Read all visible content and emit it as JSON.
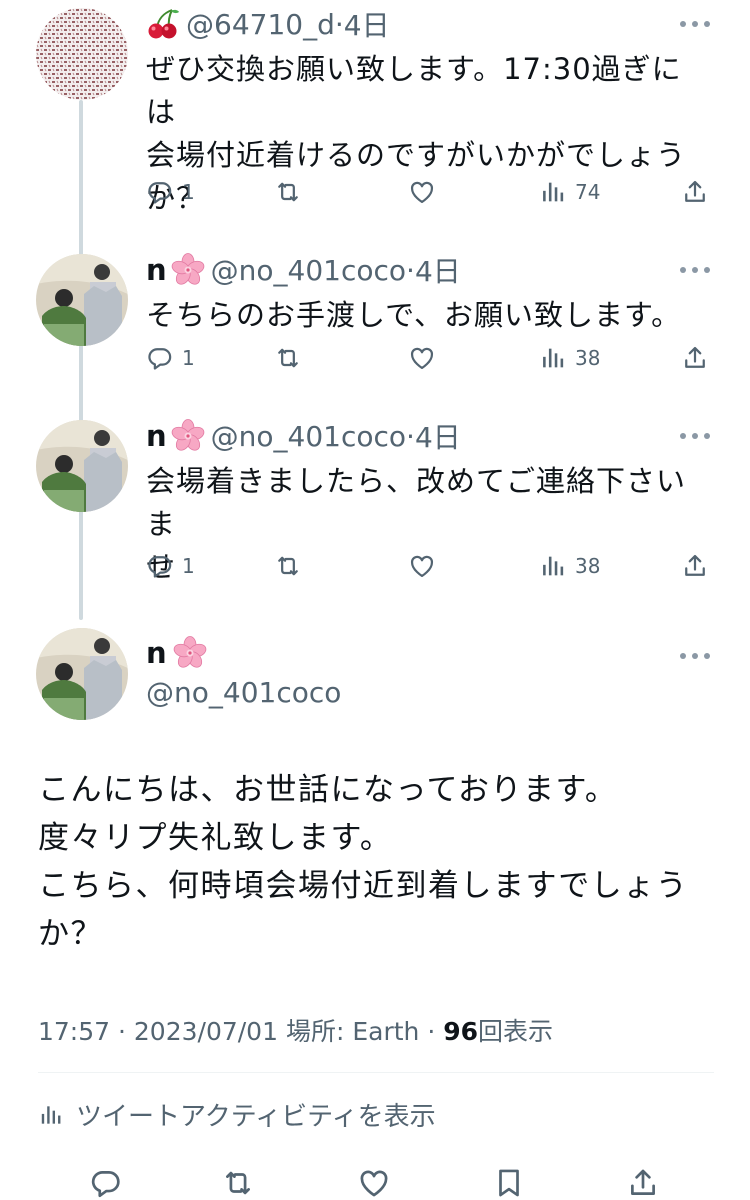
{
  "replies": [
    {
      "name": "",
      "emoji": "cherry-emoji",
      "handle": "@64710_d",
      "time": "4日",
      "text_lines": [
        "ぜひ交換お願い致します。17:30過ぎには",
        "会場付近着けるのですがいかがでしょう",
        "か？"
      ],
      "reply_count": "1",
      "retweet_count": "",
      "like_count": "",
      "views": "74"
    },
    {
      "name": "n",
      "emoji": "cherry-blossom-emoji",
      "handle": "@no_401coco",
      "time": "4日",
      "text_lines": [
        "そちらのお手渡しで、お願い致します。"
      ],
      "reply_count": "1",
      "retweet_count": "",
      "like_count": "",
      "views": "38"
    },
    {
      "name": "n",
      "emoji": "cherry-blossom-emoji",
      "handle": "@no_401coco",
      "time": "4日",
      "text_lines": [
        "会場着きましたら、改めてご連絡下さいま",
        "せ"
      ],
      "reply_count": "1",
      "retweet_count": "",
      "like_count": "",
      "views": "38"
    }
  ],
  "main_tweet": {
    "name": "n",
    "emoji": "cherry-blossom-emoji",
    "handle": "@no_401coco",
    "text_lines": [
      "こんにちは、お世話になっております。",
      "度々リプ失礼致します。",
      "こちら、何時頃会場付近到着しますでしょう",
      "か？"
    ],
    "time": "17:57",
    "separator": "·",
    "date": "2023/07/01",
    "location_label": "場所: Earth",
    "views_count": "96",
    "views_label": "回表示"
  },
  "activity_label": "ツイートアクティビティを表示",
  "colors": {
    "text": "#0f1419",
    "muted": "#536471",
    "line": "#cfd9de",
    "blossom": "#f7a8c4",
    "cherry": "#d81b38"
  }
}
